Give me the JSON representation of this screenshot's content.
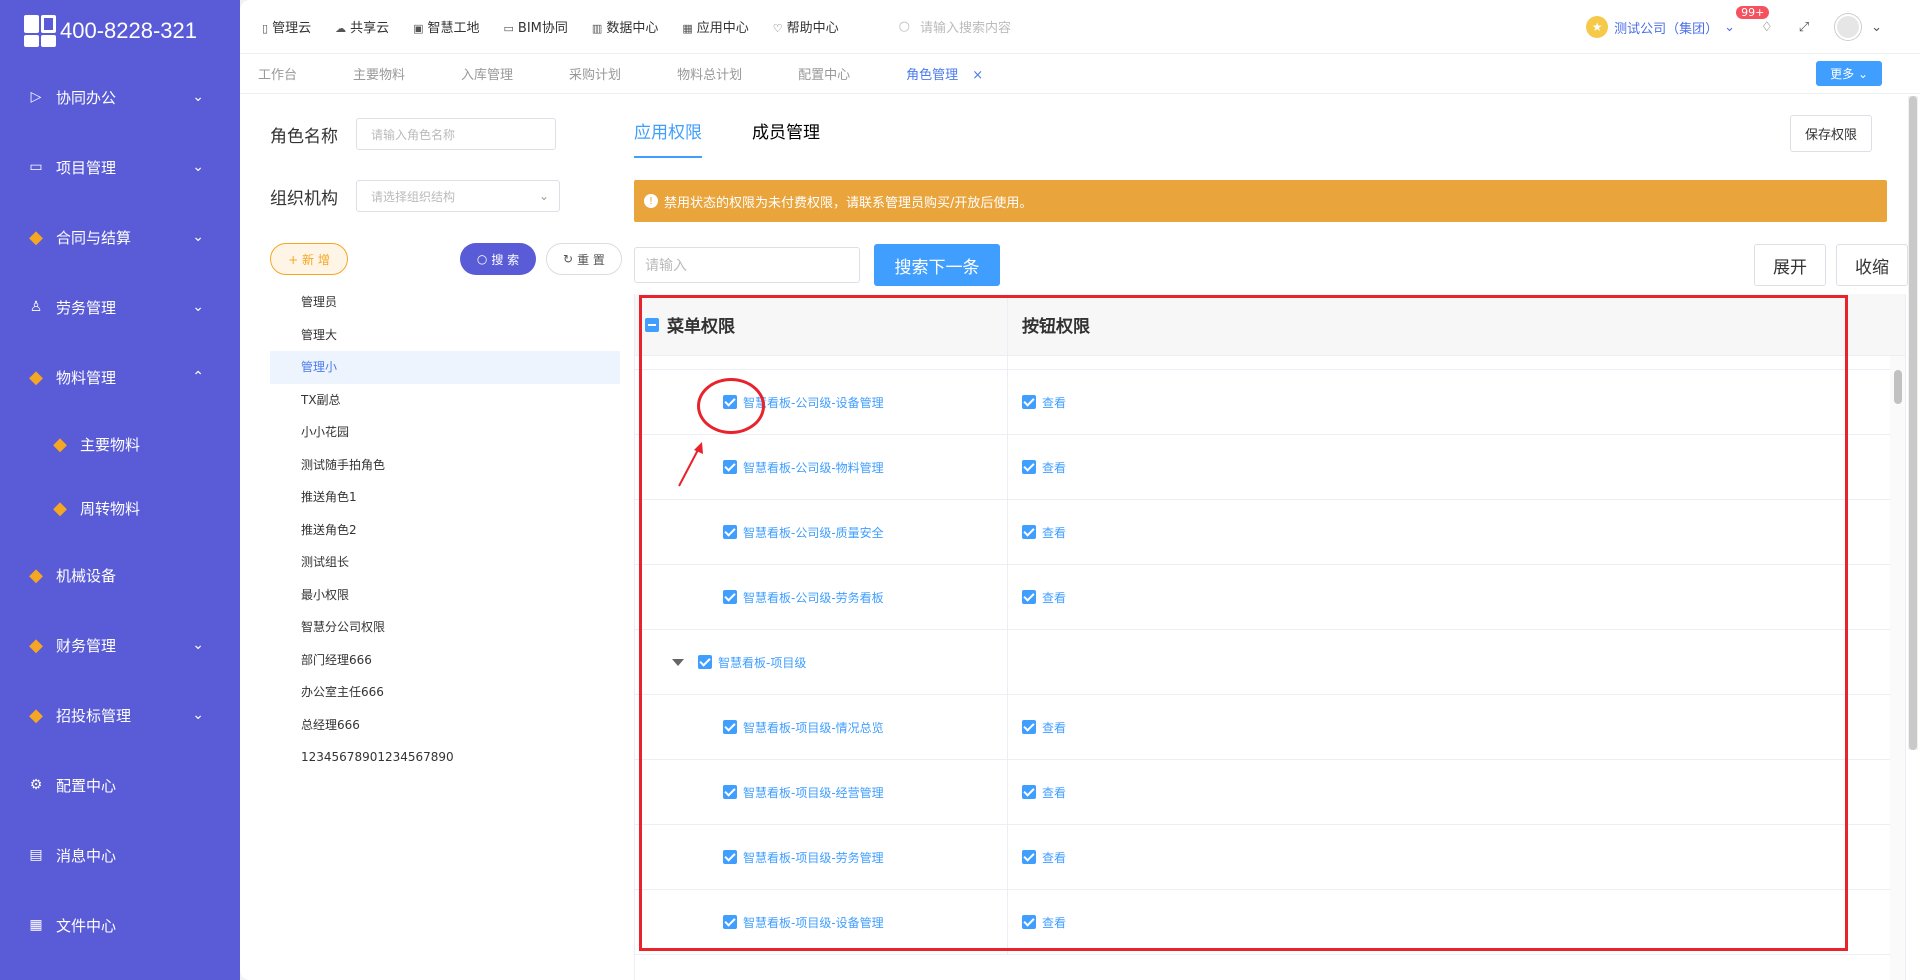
{
  "brand": {
    "phone": "400-8228-321"
  },
  "sidebar": {
    "items": [
      {
        "label": "协同办公",
        "icon": "send-icon"
      },
      {
        "label": "项目管理",
        "icon": "book-icon"
      },
      {
        "label": "合同与结算",
        "icon": "gem-icon"
      },
      {
        "label": "劳务管理",
        "icon": "user-icon"
      },
      {
        "label": "物料管理",
        "icon": "gem-icon"
      },
      {
        "label": "主要物料",
        "icon": "gem-icon"
      },
      {
        "label": "周转物料",
        "icon": "gem-icon"
      },
      {
        "label": "机械设备",
        "icon": "gem-icon"
      },
      {
        "label": "财务管理",
        "icon": "gem-icon"
      },
      {
        "label": "招投标管理",
        "icon": "gem-icon"
      },
      {
        "label": "配置中心",
        "icon": "gear-icon"
      },
      {
        "label": "消息中心",
        "icon": "message-icon"
      },
      {
        "label": "文件中心",
        "icon": "file-icon"
      }
    ]
  },
  "topnav": {
    "items": [
      "管理云",
      "共享云",
      "智慧工地",
      "BIM协同",
      "数据中心",
      "应用中心",
      "帮助中心"
    ],
    "search_placeholder": "请输入搜索内容",
    "company": "测试公司（集团）",
    "notification_count": "99+"
  },
  "tabs": {
    "items": [
      "工作台",
      "主要物料",
      "入库管理",
      "采购计划",
      "物料总计划",
      "配置中心",
      "角色管理"
    ],
    "close": "×",
    "more": "更多"
  },
  "filter": {
    "role_name_label": "角色名称",
    "role_name_placeholder": "请输入角色名称",
    "org_label": "组织机构",
    "org_placeholder": "请选择组织结构",
    "add_label": "+ 新 增",
    "search_label": "搜 索",
    "reset_label": "重 置"
  },
  "roles": [
    "管理员",
    "管理大",
    "管理小",
    "TX副总",
    "小小花园",
    "测试随手拍角色",
    "推送角色1",
    "推送角色2",
    "测试组长",
    "最小权限",
    "智慧分公司权限",
    "部门经理666",
    "办公室主任666",
    "总经理666",
    "12345678901234567890"
  ],
  "perm": {
    "tab_app": "应用权限",
    "tab_members": "成员管理",
    "save_label": "保存权限",
    "alert": "禁用状态的权限为未付费权限，请联系管理员购买/开放后使用。",
    "input_placeholder": "请输入",
    "next_label": "搜索下一条",
    "expand_label": "展开",
    "collapse_label": "收缩",
    "col_menu": "菜单权限",
    "col_button": "按钮权限",
    "rows": [
      {
        "menu": "智慧看板-公司级-设备管理",
        "button": "查看",
        "level": 2
      },
      {
        "menu": "智慧看板-公司级-物料管理",
        "button": "查看",
        "level": 2
      },
      {
        "menu": "智慧看板-公司级-质量安全",
        "button": "查看",
        "level": 2
      },
      {
        "menu": "智慧看板-公司级-劳务看板",
        "button": "查看",
        "level": 2
      },
      {
        "menu": "智慧看板-项目级",
        "button": "",
        "level": 1
      },
      {
        "menu": "智慧看板-项目级-情况总览",
        "button": "查看",
        "level": 2
      },
      {
        "menu": "智慧看板-项目级-经营管理",
        "button": "查看",
        "level": 2
      },
      {
        "menu": "智慧看板-项目级-劳务管理",
        "button": "查看",
        "level": 2
      },
      {
        "menu": "智慧看板-项目级-设备管理",
        "button": "查看",
        "level": 2
      }
    ]
  }
}
